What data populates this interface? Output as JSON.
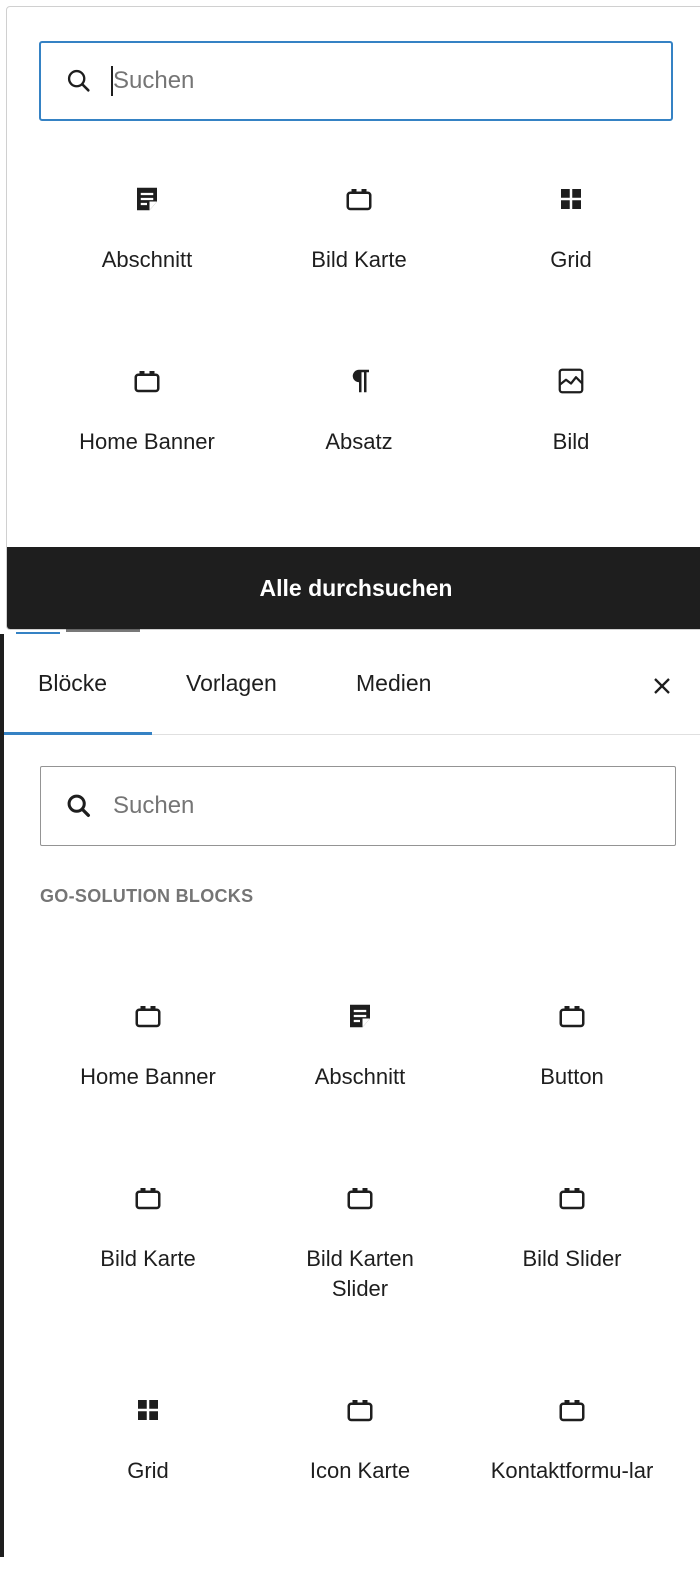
{
  "quick_inserter": {
    "search": {
      "placeholder": "Suchen"
    },
    "blocks": [
      {
        "label": "Abschnitt",
        "icon": "section-icon"
      },
      {
        "label": "Bild Karte",
        "icon": "block-default-icon"
      },
      {
        "label": "Grid",
        "icon": "grid-icon"
      },
      {
        "label": "Home Banner",
        "icon": "block-default-icon"
      },
      {
        "label": "Absatz",
        "icon": "paragraph-icon"
      },
      {
        "label": "Bild",
        "icon": "image-icon"
      }
    ],
    "browse_all_label": "Alle durchsuchen"
  },
  "inserter_panel": {
    "tabs": [
      {
        "label": "Blöcke",
        "active": true
      },
      {
        "label": "Vorlagen",
        "active": false
      },
      {
        "label": "Medien",
        "active": false
      }
    ],
    "search": {
      "placeholder": "Suchen"
    },
    "category_title": "GO-SOLUTION BLOCKS",
    "blocks": [
      {
        "label": "Home Banner",
        "icon": "block-default-icon"
      },
      {
        "label": "Abschnitt",
        "icon": "section-icon"
      },
      {
        "label": "Button",
        "icon": "block-default-icon"
      },
      {
        "label": "Bild Karte",
        "icon": "block-default-icon"
      },
      {
        "label": "Bild Karten Slider",
        "icon": "block-default-icon"
      },
      {
        "label": "Bild Slider",
        "icon": "block-default-icon"
      },
      {
        "label": "Grid",
        "icon": "grid-icon"
      },
      {
        "label": "Icon Karte",
        "icon": "block-default-icon"
      },
      {
        "label": "Kontaktformu-lar",
        "icon": "block-default-icon"
      }
    ]
  },
  "colors": {
    "accent": "#3582c4",
    "dark": "#1e1e1e",
    "muted": "#757575"
  }
}
